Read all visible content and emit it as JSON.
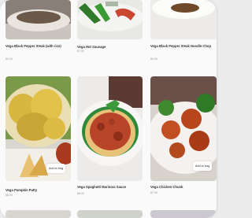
{
  "products": [
    {
      "title": "Vega Black Pepper Steak (with rice)",
      "price": "$9.00",
      "button": ""
    },
    {
      "title": "Vega Hot Sausage",
      "price": "$7.50",
      "button": ""
    },
    {
      "title": "Vega Black Pepper Steak Noodle Chop",
      "price": "$9.50",
      "button": ""
    },
    {
      "title": "Vega Pumpkin Patty",
      "price": "$6.00",
      "button": "Add to bag"
    },
    {
      "title": "Vega Spaghetti Marinara Sauce",
      "price": "$8.00",
      "button": ""
    },
    {
      "title": "Vega Chicken Chunk",
      "price": "$7.00",
      "button": "Add to bag"
    }
  ],
  "colors": {
    "background": "#fafafa",
    "text": "#333333",
    "muted": "#999999"
  }
}
